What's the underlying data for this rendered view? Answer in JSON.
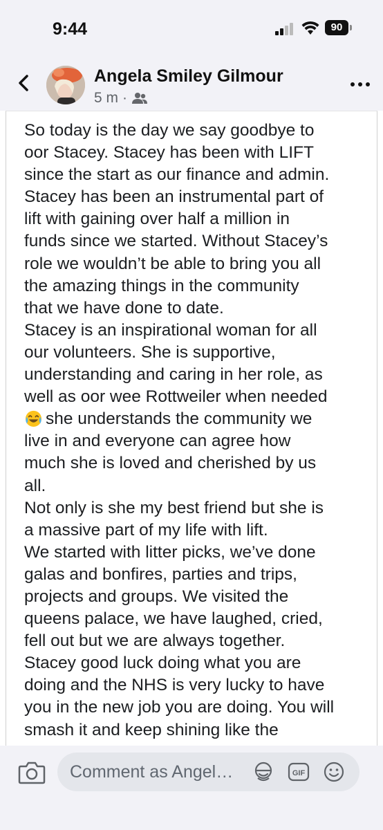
{
  "status_bar": {
    "time": "9:44",
    "battery": "90"
  },
  "header": {
    "author": "Angela Smiley Gilmour",
    "time_ago": "5 m",
    "separator": "·",
    "audience_icon": "friends-icon"
  },
  "post": {
    "lines": [
      "So today is the day we say goodbye to",
      "oor Stacey. Stacey has been with LIFT",
      "since the start as our finance and admin.",
      "Stacey has been an instrumental part of",
      "lift with gaining over half a million in",
      "funds since we started. Without Stacey’s",
      "role we wouldn’t be able to bring you all",
      "the amazing things in the community",
      "that we have done to date.",
      "Stacey is an inspirational woman for all",
      "our volunteers. She is supportive,",
      "understanding and caring in her role, as",
      "well as oor wee Rottweiler when needed",
      "she understands the community we",
      "live in and everyone can agree how",
      "much she is loved and cherished by us",
      "all.",
      "Not only is she my best friend but she is",
      "a massive part of my life with lift.",
      "We started with litter picks, we’ve done",
      "galas and bonfires, parties and trips,",
      "projects and groups. We visited the",
      "queens palace, we have laughed, cried,",
      "fell out but we are always together.",
      "Stacey good luck doing what you are",
      "doing and the NHS is very lucky to have",
      "you in the new job you are doing. You will",
      "smash it and keep shining like the"
    ],
    "emoji_line_index": 13,
    "emoji_icon": "tears-of-joy-emoji-icon"
  },
  "comment_bar": {
    "placeholder": "Comment as Angel…",
    "icons": [
      "camera-icon",
      "avatar-sticker-icon",
      "gif-icon",
      "emoji-icon"
    ]
  },
  "colors": {
    "bar_background": "#f2f2f7",
    "input_background": "#e4e6eb",
    "text": "#1c1e21",
    "meta": "#5f6368"
  }
}
